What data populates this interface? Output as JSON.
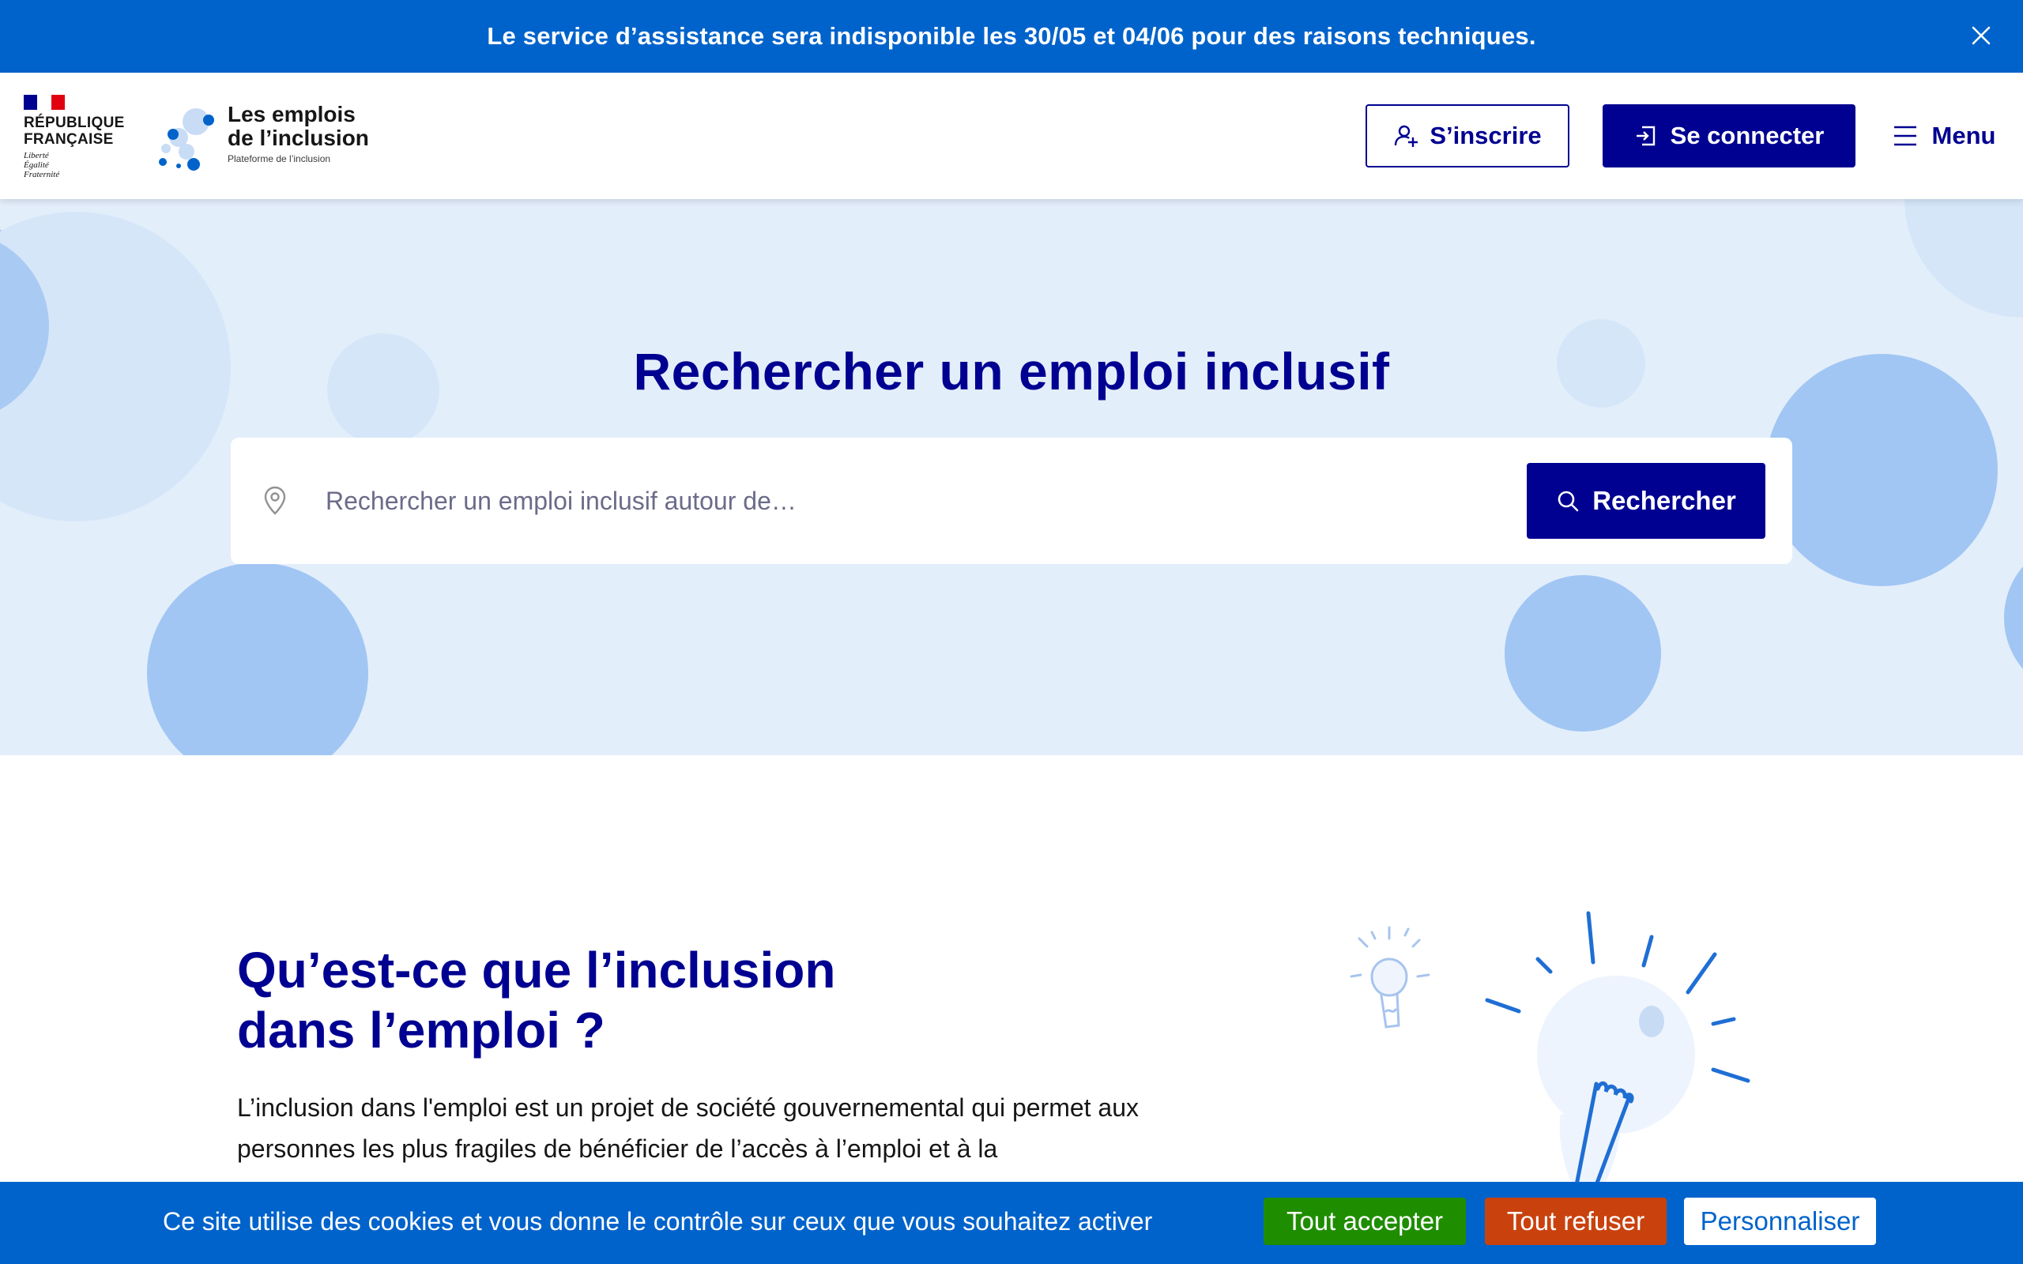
{
  "banner": {
    "text": "Le service d’assistance sera indisponible les 30/05 et 04/06 pour des raisons techniques.",
    "close_icon": "close-icon"
  },
  "header": {
    "republic": {
      "name_line1": "RÉPUBLIQUE",
      "name_line2": "FRANÇAISE",
      "motto_line1": "Liberté",
      "motto_line2": "Égalité",
      "motto_line3": "Fraternité"
    },
    "brand": {
      "title_line1": "Les emplois",
      "title_line2": "de l’inclusion",
      "subtitle": "Plateforme de l’inclusion"
    },
    "signup_label": "S’inscrire",
    "login_label": "Se connecter",
    "menu_label": "Menu"
  },
  "hero": {
    "title": "Rechercher un emploi inclusif",
    "search_placeholder": "Rechercher un emploi inclusif autour de…",
    "search_button": "Rechercher"
  },
  "info": {
    "title_line1": "Qu’est-ce que l’inclusion",
    "title_line2": "dans l’emploi ?",
    "text": "L’inclusion dans l'emploi est un projet de société gouvernemental qui permet aux personnes les plus fragiles de bénéficier de l’accès à l’emploi et à la"
  },
  "cookies": {
    "text": "Ce site utilise des cookies et vous donne le contrôle sur ceux que vous souhaitez activer",
    "accept": "Tout accepter",
    "refuse": "Tout refuser",
    "customize": "Personnaliser"
  },
  "colors": {
    "primary": "#000091",
    "banner_blue": "#0063cb",
    "hero_bg": "#e3eefb",
    "bubble": "#a1c6f3",
    "accept_green": "#1f8d00",
    "refuse_orange": "#c9420e"
  }
}
